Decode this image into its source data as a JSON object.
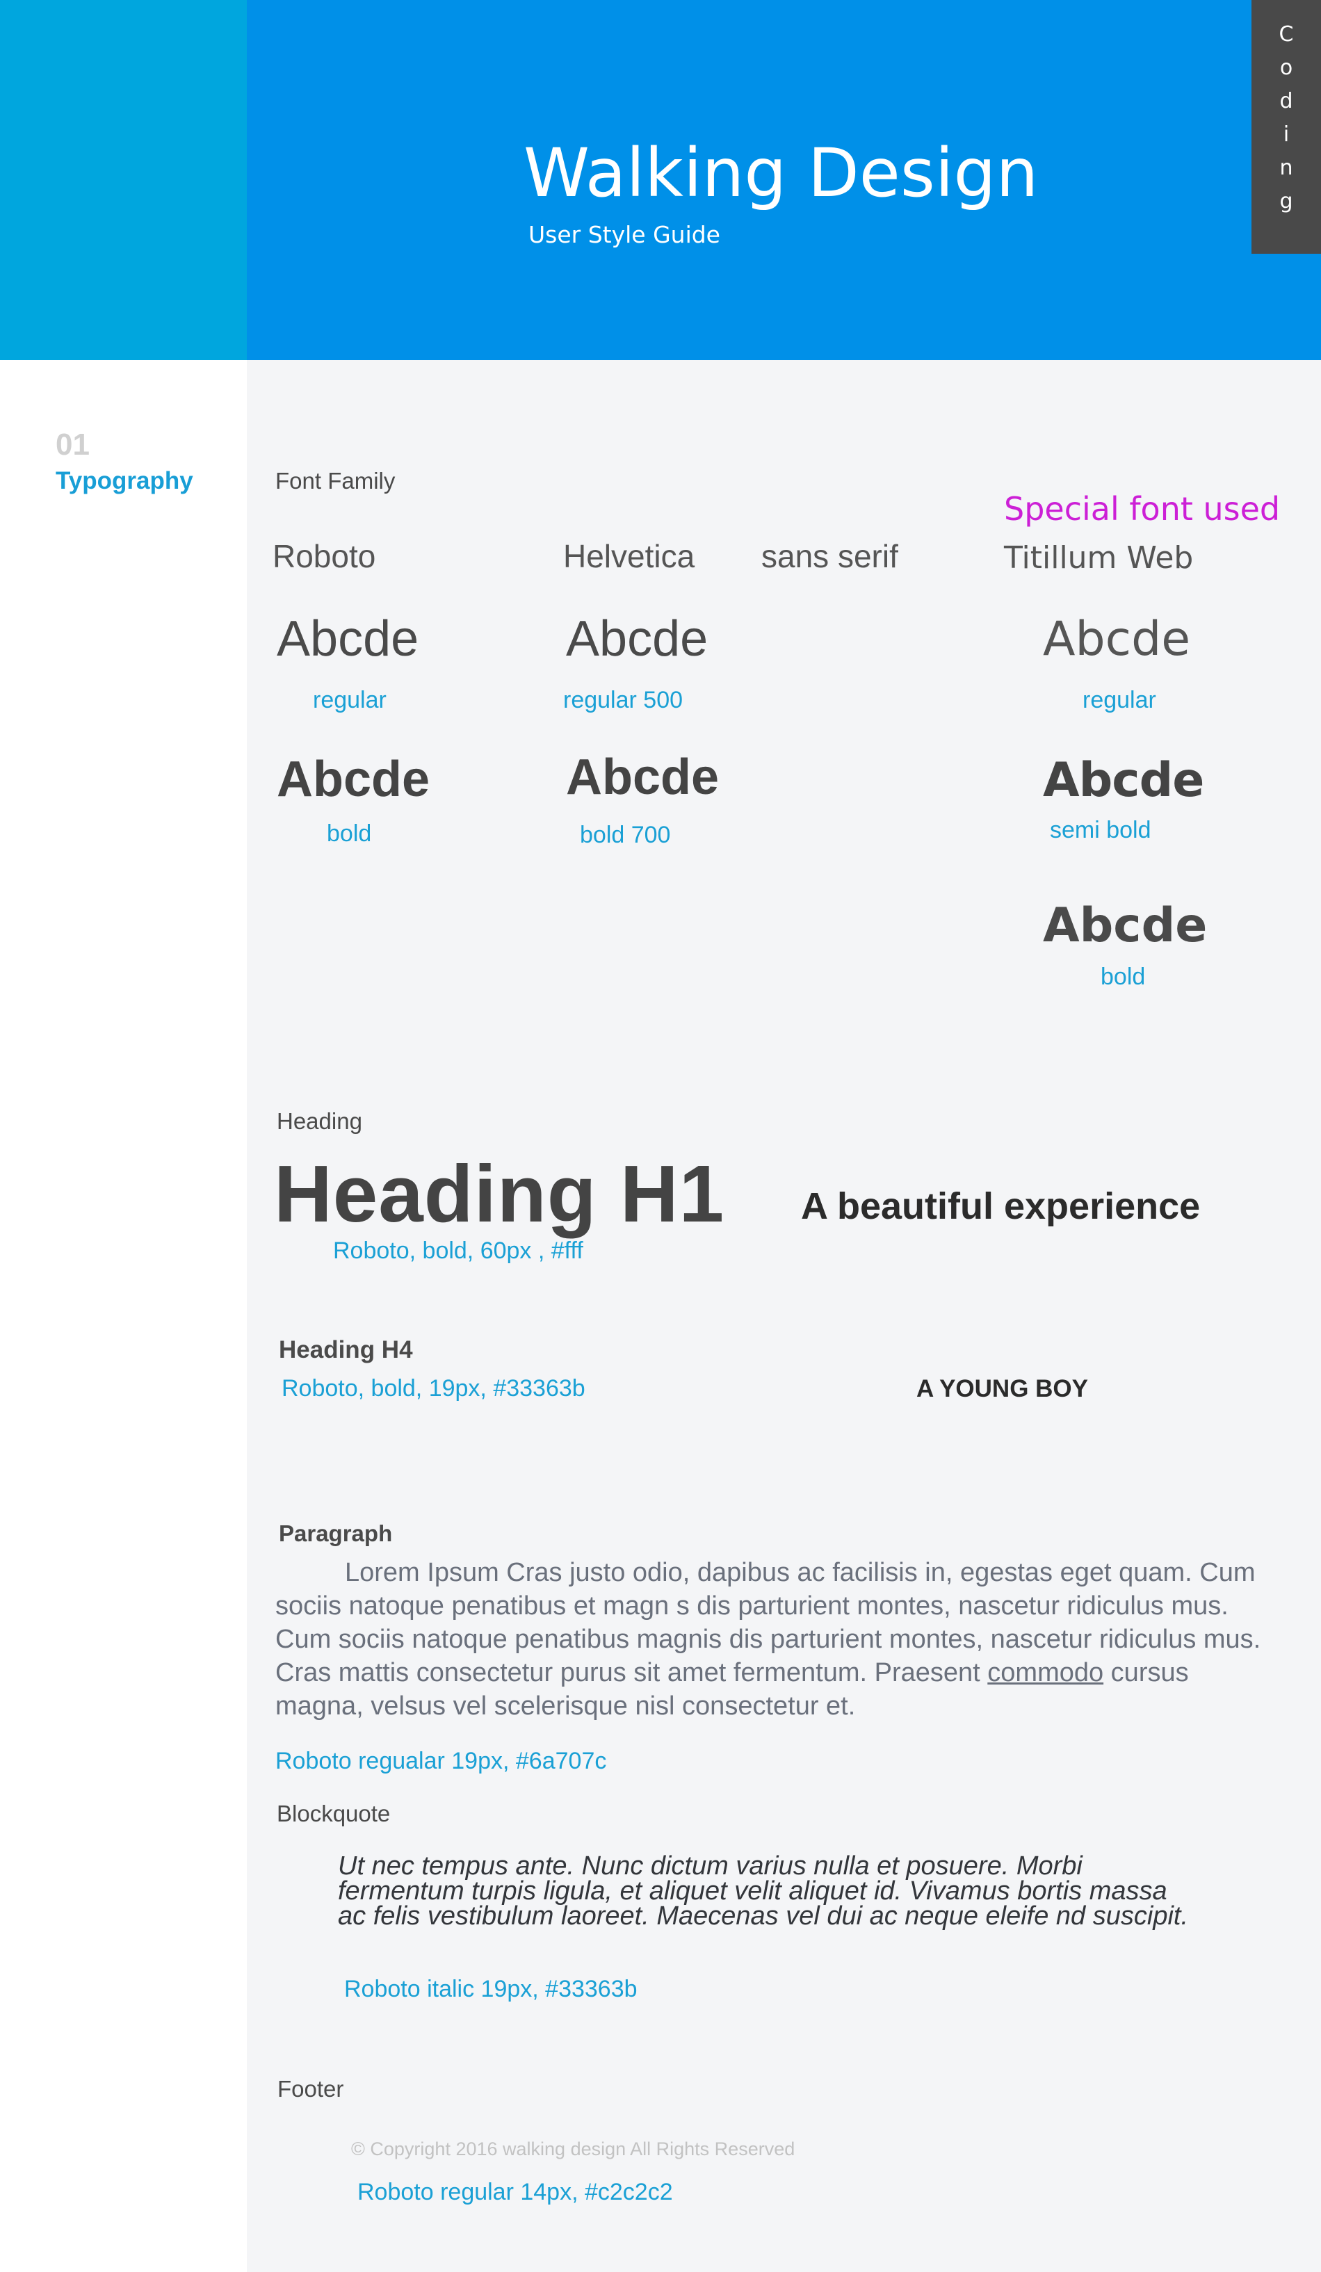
{
  "header": {
    "title": "Walking Design",
    "subtitle": "User Style Guide",
    "coding_tab_letters": [
      "C",
      "o",
      "d",
      "i",
      "n",
      "g"
    ],
    "colors": {
      "left_band": "#00a6de",
      "main_band": "#0090e8",
      "tab": "#494949"
    }
  },
  "side": {
    "section_number": "01",
    "section_name": "Typography"
  },
  "font_family": {
    "label": "Font Family",
    "special_note": "Special font used",
    "fonts": [
      "Roboto",
      "Helvetica",
      "sans serif",
      "Titillum Web"
    ],
    "sample_text": "Abcde",
    "weights": {
      "roboto_regular": "regular",
      "roboto_bold": "bold",
      "helvetica_regular": "regular 500",
      "helvetica_bold": "bold 700",
      "titillium_regular": "regular",
      "titillium_semibold": "semi bold",
      "titillium_bold": "bold"
    }
  },
  "heading": {
    "label": "Heading",
    "h1_sample": "Heading H1",
    "h1_spec": "Roboto, bold, 60px , #fff",
    "h1_example": "A beautiful experience",
    "h4_label": "Heading H4",
    "h4_spec": "Roboto, bold, 19px, #33363b",
    "h4_example": "A YOUNG BOY"
  },
  "paragraph": {
    "label": "Paragraph",
    "text_before_link": "Lorem Ipsum Cras justo odio, dapibus ac facilisis in, egestas eget quam. Cum sociis natoque penatibus    et magn  s dis parturient montes, nascetur ridiculus mus. Cum sociis natoque penatibus  magnis dis parturient  montes,  nascetur ridiculus mus. Cras mattis consectetur purus sit amet fermentum. Praesent ",
    "link_text": "commodo",
    "text_after_link": " cursus magna, velsus vel scelerisque nisl consectetur et.",
    "spec": "Roboto regualar  19px, #6a707c"
  },
  "blockquote": {
    "label": "Blockquote",
    "text": "Ut nec tempus ante. Nunc dictum varius nulla et posuere. Morbi fermentum turpis ligula, et aliquet velit aliquet id. Vivamus bortis massa ac felis vestibulum laoreet. Maecenas vel dui ac neque eleife nd suscipit.",
    "spec": "Roboto italic  19px, #33363b"
  },
  "footer": {
    "label": "Footer",
    "copyright": "© Copyright 2016  walking design  All Rights Reserved",
    "spec": "Roboto regular 14px, #c2c2c2"
  },
  "colors": {
    "accent_blue": "#1aa0d5",
    "special_magenta": "#cc1fd6",
    "paragraph": "#6a707c",
    "footer_text": "#c2c2c2"
  }
}
